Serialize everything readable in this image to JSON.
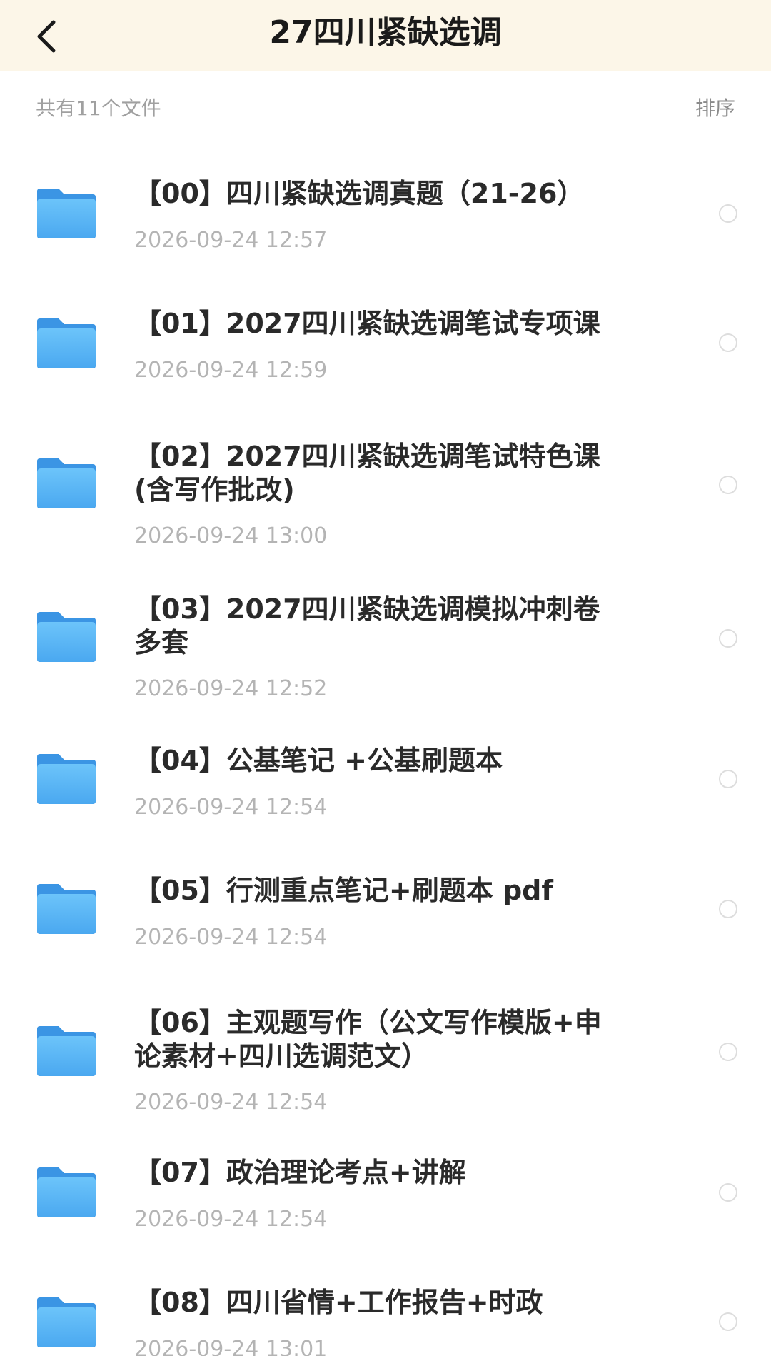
{
  "header": {
    "title": "27四川紧缺选调"
  },
  "toolbar": {
    "count_text": "共有11个文件",
    "sort_label": "排序"
  },
  "colors": {
    "header_bg": "#fcf6e8",
    "folder_top": "#6cc0f8",
    "folder_bottom": "#4aa6ef"
  },
  "items": [
    {
      "title": "【00】四川紧缺选调真题（21-26）",
      "date": "2026-09-24 12:57",
      "icon": "folder-icon"
    },
    {
      "title": "【01】2027四川紧缺选调笔试专项课",
      "date": "2026-09-24 12:59",
      "icon": "folder-icon"
    },
    {
      "title": "【02】2027四川紧缺选调笔试特色课(含写作批改)",
      "date": "2026-09-24 13:00",
      "icon": "folder-icon"
    },
    {
      "title": "【03】2027四川紧缺选调模拟冲刺卷多套",
      "date": "2026-09-24 12:52",
      "icon": "folder-icon"
    },
    {
      "title": "【04】公基笔记 +公基刷题本",
      "date": "2026-09-24 12:54",
      "icon": "folder-icon"
    },
    {
      "title": "【05】行测重点笔记+刷题本 pdf",
      "date": "2026-09-24 12:54",
      "icon": "folder-icon"
    },
    {
      "title": "【06】主观题写作（公文写作模版+申论素材+四川选调范文）",
      "date": "2026-09-24 12:54",
      "icon": "folder-icon"
    },
    {
      "title": "【07】政治理论考点+讲解",
      "date": "2026-09-24 12:54",
      "icon": "folder-icon"
    },
    {
      "title": "【08】四川省情+工作报告+时政",
      "date": "2026-09-24 13:01",
      "icon": "folder-icon"
    }
  ]
}
